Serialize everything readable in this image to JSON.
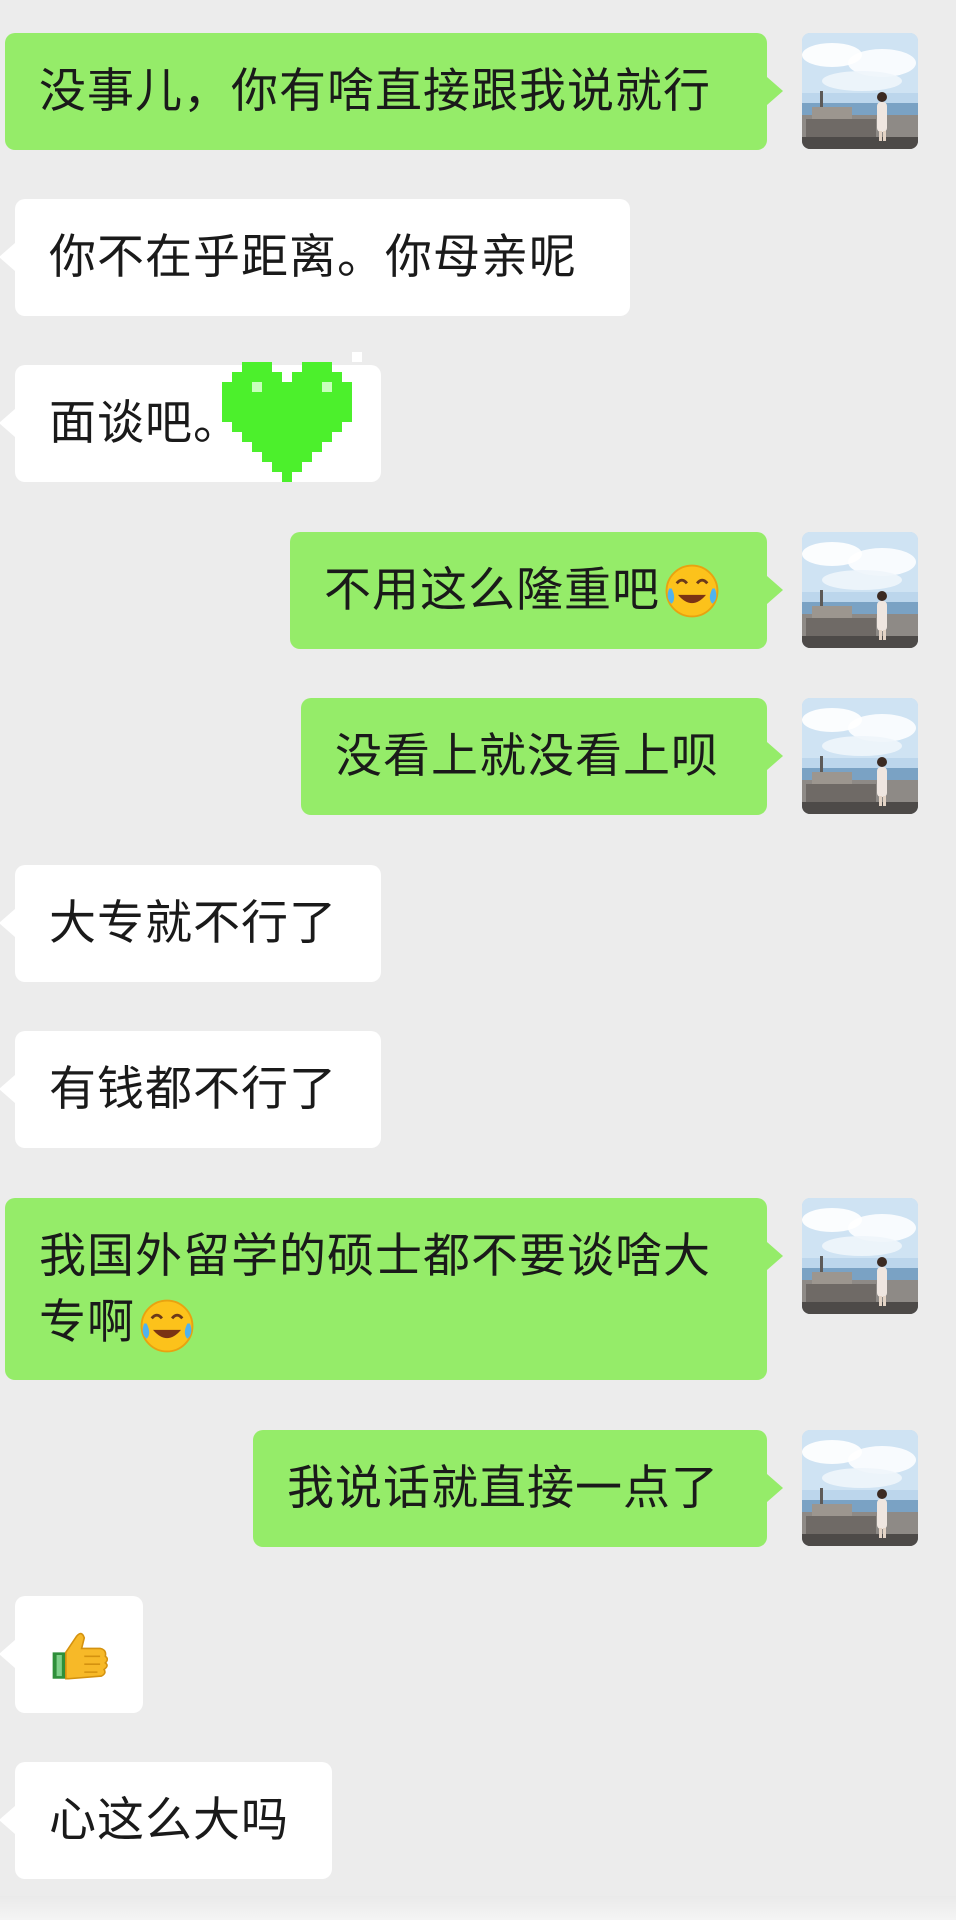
{
  "chat": {
    "messages": [
      {
        "side": "sent",
        "text": "没事儿，你有啥直接跟我说就行"
      },
      {
        "side": "received",
        "text": "你不在乎距离。你母亲呢"
      },
      {
        "side": "received",
        "text": "面谈吧。",
        "sticker": "green-pixel-heart-sticker"
      },
      {
        "side": "sent",
        "text": "不用这么隆重吧",
        "emoji": "tears-of-joy-emoji"
      },
      {
        "side": "sent",
        "text": "没看上就没看上呗"
      },
      {
        "side": "received",
        "text": "大专就不行了"
      },
      {
        "side": "received",
        "text": "有钱都不行了"
      },
      {
        "side": "sent",
        "line1": "我国外留学的硕士都不要谈啥大",
        "line2": "专啊",
        "emoji": "tears-of-joy-emoji"
      },
      {
        "side": "sent",
        "text": "我说话就直接一点了"
      },
      {
        "side": "received",
        "emoji": "thumbs-up-emoji"
      },
      {
        "side": "received",
        "text": "心这么大吗"
      }
    ]
  },
  "colors": {
    "background": "#ececec",
    "sent_bubble": "#95ec69",
    "received_bubble": "#ffffff"
  },
  "icons": {
    "sender_avatar": "avatar-seaside-photo",
    "heart_sticker": "green-pixel-heart-sticker",
    "laugh_cry": "tears-of-joy-emoji",
    "thumbs_up": "thumbs-up-emoji"
  }
}
